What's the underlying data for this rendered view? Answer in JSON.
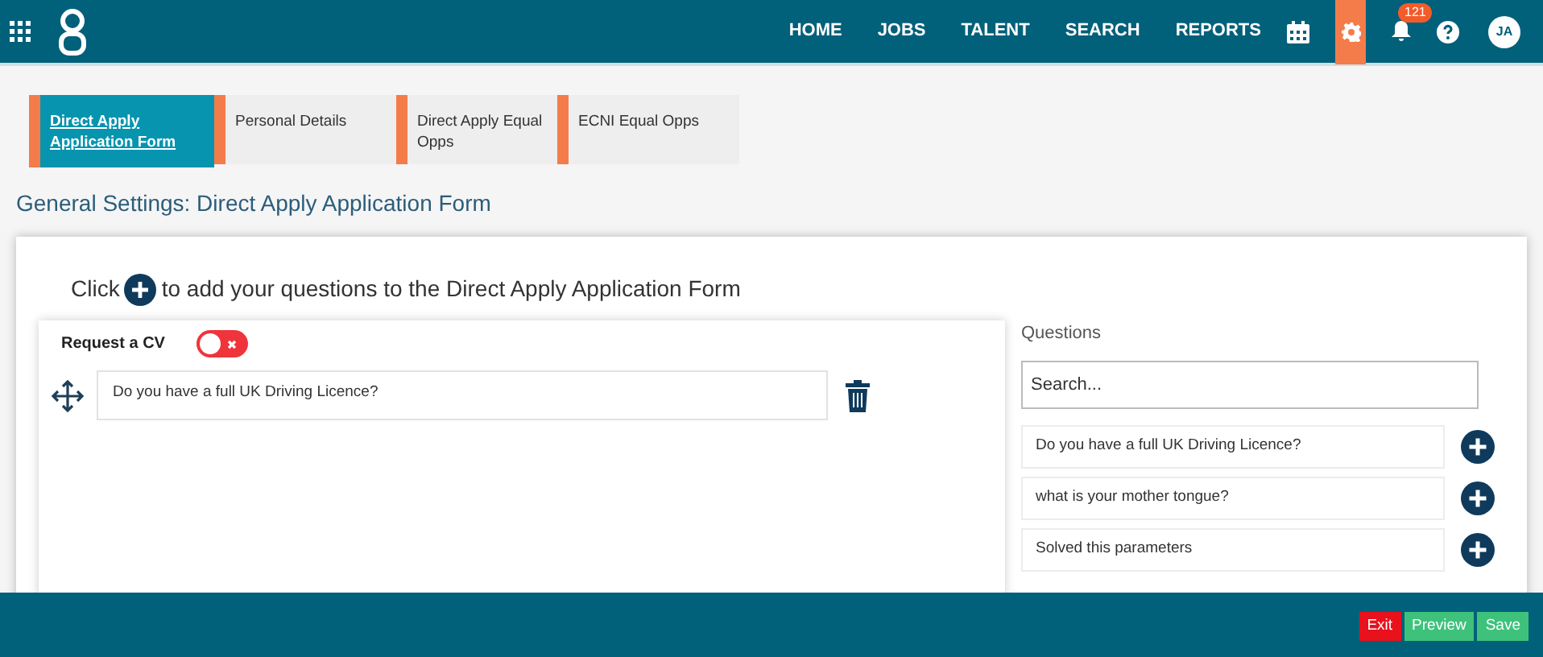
{
  "nav": {
    "links": [
      {
        "label": "HOME"
      },
      {
        "label": "JOBS"
      },
      {
        "label": "TALENT"
      },
      {
        "label": "SEARCH"
      },
      {
        "label": "REPORTS"
      }
    ],
    "settings_selected": true,
    "notifications_badge": "121",
    "avatar": "JA"
  },
  "tabs": [
    {
      "label": "Direct Apply Application Form",
      "selected": true
    },
    {
      "label": "Personal Details",
      "selected": false
    },
    {
      "label": "Direct Apply Equal Opps",
      "selected": false
    },
    {
      "label": "ECNI Equal Opps",
      "selected": false
    }
  ],
  "page_title": "General Settings: Direct Apply Application Form",
  "instruction": {
    "before": "Click",
    "after": "to add your questions to the Direct Apply Application Form"
  },
  "form": {
    "request_cv": {
      "label": "Request a CV",
      "on": false
    },
    "questions": [
      {
        "text": "Do you have a full UK Driving Licence?"
      }
    ]
  },
  "question_bank": {
    "title": "Questions",
    "search": {
      "placeholder": "Search..."
    },
    "items": [
      {
        "text": "Do you have a full UK Driving Licence?"
      },
      {
        "text": "what is your mother tongue?"
      },
      {
        "text": "Solved this parameters"
      }
    ]
  },
  "footer": {
    "buttons": [
      {
        "label": "Exit",
        "kind": "danger"
      },
      {
        "label": "Preview",
        "kind": "success"
      },
      {
        "label": "Save",
        "kind": "success"
      }
    ]
  }
}
